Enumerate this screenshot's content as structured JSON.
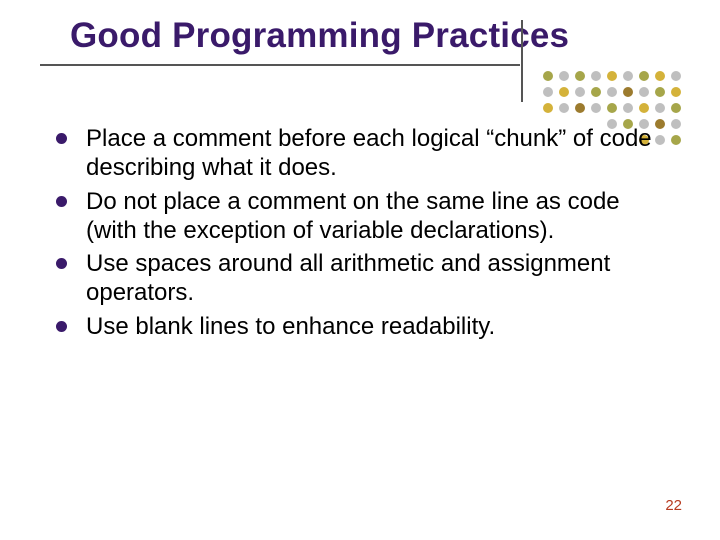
{
  "slide": {
    "title": "Good Programming Practices",
    "bullets": [
      "Place a comment before each logical “chunk” of code describing what it does.",
      "Do not place a comment on the same line as code (with the exception of variable declarations).",
      "Use spaces around all arithmetic and assignment operators.",
      "Use blank lines to enhance readability."
    ],
    "page_number": "22"
  },
  "decor": {
    "dot_colors": {
      "olive": "#a6a64a",
      "gray": "#bfbfbf",
      "gold": "#d4b23a",
      "brown": "#9c7b2e"
    }
  }
}
